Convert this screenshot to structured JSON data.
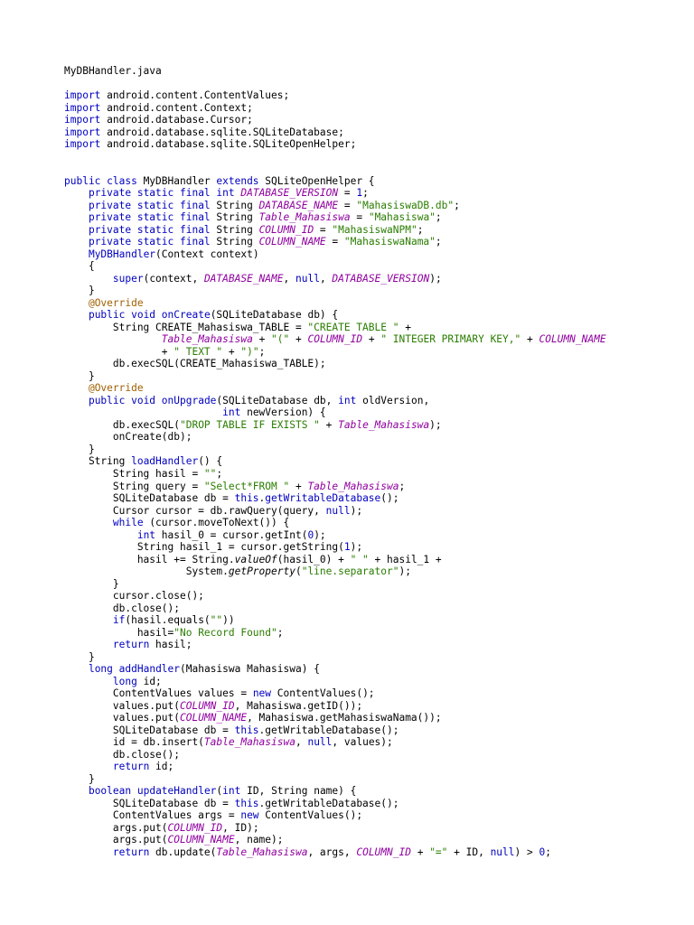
{
  "document": {
    "filename": "MyDBHandler.java"
  },
  "colors": {
    "keyword": "#0000c0",
    "string": "#2a7d00",
    "field": "#9000a0",
    "annotation": "#a06000",
    "plain": "#000000"
  },
  "code_lines": [
    [
      [
        "p",
        "import android.content.ContentValues;"
      ]
    ],
    [
      [
        "k",
        "import"
      ],
      [
        "p",
        " android.content.Context;"
      ]
    ],
    [
      [
        "k",
        "import"
      ],
      [
        "p",
        " android.database.Cursor;"
      ]
    ],
    [
      [
        "k",
        "import"
      ],
      [
        "p",
        " android.database.sqlite.SQLiteDatabase;"
      ]
    ],
    [
      [
        "k",
        "import"
      ],
      [
        "p",
        " android.database.sqlite.SQLiteOpenHelper;"
      ]
    ],
    [],
    [],
    [
      [
        "k",
        "public class"
      ],
      [
        "p",
        " MyDBHandler "
      ],
      [
        "k",
        "extends"
      ],
      [
        "p",
        " SQLiteOpenHelper {"
      ]
    ],
    [
      [
        "p",
        "    "
      ],
      [
        "k",
        "private static final int"
      ],
      [
        "p",
        " "
      ],
      [
        "f",
        "DATABASE_VERSION"
      ],
      [
        "p",
        " = "
      ],
      [
        "n",
        "1"
      ],
      [
        "p",
        ";"
      ]
    ],
    [
      [
        "p",
        "    "
      ],
      [
        "k",
        "private static final"
      ],
      [
        "p",
        " String "
      ],
      [
        "f",
        "DATABASE_NAME"
      ],
      [
        "p",
        " = "
      ],
      [
        "s",
        "\"MahasiswaDB.db\""
      ],
      [
        "p",
        ";"
      ]
    ],
    [
      [
        "p",
        "    "
      ],
      [
        "k",
        "private static final"
      ],
      [
        "p",
        " String "
      ],
      [
        "f",
        "Table_Mahasiswa"
      ],
      [
        "p",
        " = "
      ],
      [
        "s",
        "\"Mahasiswa\""
      ],
      [
        "p",
        ";"
      ]
    ],
    [
      [
        "p",
        "    "
      ],
      [
        "k",
        "private static final"
      ],
      [
        "p",
        " String "
      ],
      [
        "f",
        "COLUMN_ID"
      ],
      [
        "p",
        " = "
      ],
      [
        "s",
        "\"MahasiswaNPM\""
      ],
      [
        "p",
        ";"
      ]
    ],
    [
      [
        "p",
        "    "
      ],
      [
        "k",
        "private static final"
      ],
      [
        "p",
        " String "
      ],
      [
        "f",
        "COLUMN_NAME"
      ],
      [
        "p",
        " = "
      ],
      [
        "s",
        "\"MahasiswaNama\""
      ],
      [
        "p",
        ";"
      ]
    ],
    [
      [
        "p",
        "    "
      ],
      [
        "m",
        "MyDBHandler"
      ],
      [
        "p",
        "(Context context)"
      ]
    ],
    [
      [
        "p",
        "    {"
      ]
    ],
    [
      [
        "p",
        "        "
      ],
      [
        "k",
        "super"
      ],
      [
        "p",
        "(context, "
      ],
      [
        "f",
        "DATABASE_NAME"
      ],
      [
        "p",
        ", "
      ],
      [
        "k",
        "null"
      ],
      [
        "p",
        ", "
      ],
      [
        "f",
        "DATABASE_VERSION"
      ],
      [
        "p",
        ");"
      ]
    ],
    [
      [
        "p",
        "    }"
      ]
    ],
    [
      [
        "p",
        "    "
      ],
      [
        "a",
        "@Override"
      ]
    ],
    [
      [
        "p",
        "    "
      ],
      [
        "k",
        "public void"
      ],
      [
        "p",
        " "
      ],
      [
        "m",
        "onCreate"
      ],
      [
        "p",
        "(SQLiteDatabase db) {"
      ]
    ],
    [
      [
        "p",
        "        String CREATE_Mahasiswa_TABLE = "
      ],
      [
        "s",
        "\"CREATE TABLE \""
      ],
      [
        "p",
        " +"
      ]
    ],
    [
      [
        "p",
        "                "
      ],
      [
        "f",
        "Table_Mahasiswa"
      ],
      [
        "p",
        " + "
      ],
      [
        "s",
        "\"(\""
      ],
      [
        "p",
        " + "
      ],
      [
        "f",
        "COLUMN_ID"
      ],
      [
        "p",
        " + "
      ],
      [
        "s",
        "\" INTEGER PRIMARY KEY,\""
      ],
      [
        "p",
        " + "
      ],
      [
        "f",
        "COLUMN_NAME"
      ]
    ],
    [
      [
        "p",
        "                + "
      ],
      [
        "s",
        "\" TEXT \""
      ],
      [
        "p",
        " + "
      ],
      [
        "s",
        "\")\""
      ],
      [
        "p",
        ";"
      ]
    ],
    [
      [
        "p",
        "        db.execSQL(CREATE_Mahasiswa_TABLE);"
      ]
    ],
    [
      [
        "p",
        "    }"
      ]
    ],
    [
      [
        "p",
        "    "
      ],
      [
        "a",
        "@Override"
      ]
    ],
    [
      [
        "p",
        "    "
      ],
      [
        "k",
        "public void"
      ],
      [
        "p",
        " "
      ],
      [
        "m",
        "onUpgrade"
      ],
      [
        "p",
        "(SQLiteDatabase db, "
      ],
      [
        "k",
        "int"
      ],
      [
        "p",
        " oldVersion,"
      ]
    ],
    [
      [
        "p",
        "                          "
      ],
      [
        "k",
        "int"
      ],
      [
        "p",
        " newVersion) {"
      ]
    ],
    [
      [
        "p",
        "        db.execSQL("
      ],
      [
        "s",
        "\"DROP TABLE IF EXISTS \""
      ],
      [
        "p",
        " + "
      ],
      [
        "f",
        "Table_Mahasiswa"
      ],
      [
        "p",
        ");"
      ]
    ],
    [
      [
        "p",
        "        onCreate(db);"
      ]
    ],
    [
      [
        "p",
        "    }"
      ]
    ],
    [
      [
        "p",
        "    String "
      ],
      [
        "m",
        "loadHandler"
      ],
      [
        "p",
        "() {"
      ]
    ],
    [
      [
        "p",
        "        String hasil = "
      ],
      [
        "s",
        "\"\""
      ],
      [
        "p",
        ";"
      ]
    ],
    [
      [
        "p",
        "        String query = "
      ],
      [
        "s",
        "\"Select*FROM \""
      ],
      [
        "p",
        " + "
      ],
      [
        "f",
        "Table_Mahasiswa"
      ],
      [
        "p",
        ";"
      ]
    ],
    [
      [
        "p",
        "        SQLiteDatabase db = "
      ],
      [
        "k",
        "this"
      ],
      [
        "p",
        "."
      ],
      [
        "m",
        "getWritableDatabase"
      ],
      [
        "p",
        "();"
      ]
    ],
    [
      [
        "p",
        "        Cursor cursor = db.rawQuery(query, "
      ],
      [
        "k",
        "null"
      ],
      [
        "p",
        ");"
      ]
    ],
    [
      [
        "p",
        "        "
      ],
      [
        "k",
        "while"
      ],
      [
        "p",
        " (cursor.moveToNext()) {"
      ]
    ],
    [
      [
        "p",
        "            "
      ],
      [
        "k",
        "int"
      ],
      [
        "p",
        " hasil_0 = cursor.getInt("
      ],
      [
        "n",
        "0"
      ],
      [
        "p",
        ");"
      ]
    ],
    [
      [
        "p",
        "            String hasil_1 = cursor.getString("
      ],
      [
        "n",
        "1"
      ],
      [
        "p",
        ");"
      ]
    ],
    [
      [
        "p",
        "            hasil += String."
      ],
      [
        "i",
        "valueOf"
      ],
      [
        "p",
        "(hasil_0) + "
      ],
      [
        "s",
        "\" \""
      ],
      [
        "p",
        " + hasil_1 +"
      ]
    ],
    [
      [
        "p",
        "                    System."
      ],
      [
        "i",
        "getProperty"
      ],
      [
        "p",
        "("
      ],
      [
        "s",
        "\"line.separator\""
      ],
      [
        "p",
        ");"
      ]
    ],
    [
      [
        "p",
        "        }"
      ]
    ],
    [
      [
        "p",
        "        cursor.close();"
      ]
    ],
    [
      [
        "p",
        "        db.close();"
      ]
    ],
    [
      [
        "p",
        "        "
      ],
      [
        "k",
        "if"
      ],
      [
        "p",
        "(hasil.equals("
      ],
      [
        "s",
        "\"\""
      ],
      [
        "p",
        "))"
      ]
    ],
    [
      [
        "p",
        "            hasil="
      ],
      [
        "s",
        "\"No Record Found\""
      ],
      [
        "p",
        ";"
      ]
    ],
    [
      [
        "p",
        "        "
      ],
      [
        "k",
        "return"
      ],
      [
        "p",
        " hasil;"
      ]
    ],
    [
      [
        "p",
        "    }"
      ]
    ],
    [
      [
        "p",
        "    "
      ],
      [
        "k",
        "long"
      ],
      [
        "p",
        " "
      ],
      [
        "m",
        "addHandler"
      ],
      [
        "p",
        "(Mahasiswa Mahasiswa) {"
      ]
    ],
    [
      [
        "p",
        "        "
      ],
      [
        "k",
        "long"
      ],
      [
        "p",
        " id;"
      ]
    ],
    [
      [
        "p",
        "        ContentValues values = "
      ],
      [
        "k",
        "new"
      ],
      [
        "p",
        " ContentValues();"
      ]
    ],
    [
      [
        "p",
        "        values.put("
      ],
      [
        "f",
        "COLUMN_ID"
      ],
      [
        "p",
        ", Mahasiswa.getID());"
      ]
    ],
    [
      [
        "p",
        "        values.put("
      ],
      [
        "f",
        "COLUMN_NAME"
      ],
      [
        "p",
        ", Mahasiswa.getMahasiswaNama());"
      ]
    ],
    [
      [
        "p",
        "        SQLiteDatabase db = "
      ],
      [
        "k",
        "this"
      ],
      [
        "p",
        ".getWritableDatabase();"
      ]
    ],
    [
      [
        "p",
        "        id = db.insert("
      ],
      [
        "f",
        "Table_Mahasiswa"
      ],
      [
        "p",
        ", "
      ],
      [
        "k",
        "null"
      ],
      [
        "p",
        ", values);"
      ]
    ],
    [
      [
        "p",
        "        db.close();"
      ]
    ],
    [
      [
        "p",
        "        "
      ],
      [
        "k",
        "return"
      ],
      [
        "p",
        " id;"
      ]
    ],
    [
      [
        "p",
        "    }"
      ]
    ],
    [
      [
        "p",
        "    "
      ],
      [
        "k",
        "boolean"
      ],
      [
        "p",
        " "
      ],
      [
        "m",
        "updateHandler"
      ],
      [
        "p",
        "("
      ],
      [
        "k",
        "int"
      ],
      [
        "p",
        " ID, String name) {"
      ]
    ],
    [
      [
        "p",
        "        SQLiteDatabase db = "
      ],
      [
        "k",
        "this"
      ],
      [
        "p",
        ".getWritableDatabase();"
      ]
    ],
    [
      [
        "p",
        "        ContentValues args = "
      ],
      [
        "k",
        "new"
      ],
      [
        "p",
        " ContentValues();"
      ]
    ],
    [
      [
        "p",
        "        args.put("
      ],
      [
        "f",
        "COLUMN_ID"
      ],
      [
        "p",
        ", ID);"
      ]
    ],
    [
      [
        "p",
        "        args.put("
      ],
      [
        "f",
        "COLUMN_NAME"
      ],
      [
        "p",
        ", name);"
      ]
    ],
    [
      [
        "p",
        "        "
      ],
      [
        "k",
        "return"
      ],
      [
        "p",
        " db.update("
      ],
      [
        "f",
        "Table_Mahasiswa"
      ],
      [
        "p",
        ", args, "
      ],
      [
        "f",
        "COLUMN_ID"
      ],
      [
        "p",
        " + "
      ],
      [
        "s",
        "\"=\""
      ],
      [
        "p",
        " + ID, "
      ],
      [
        "k",
        "null"
      ],
      [
        "p",
        ") > "
      ],
      [
        "n",
        "0"
      ],
      [
        "p",
        ";"
      ]
    ]
  ]
}
